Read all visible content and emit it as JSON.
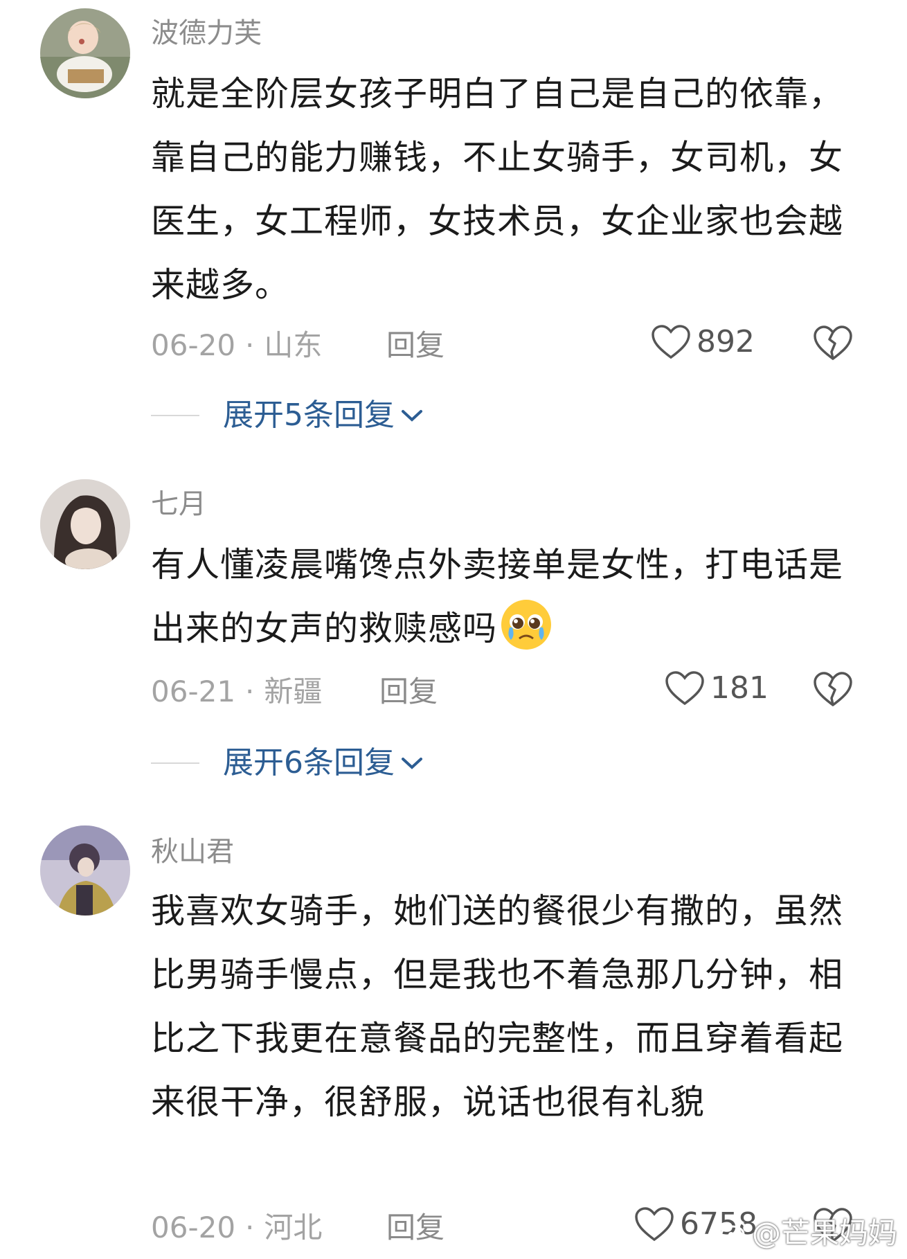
{
  "comments": [
    {
      "username": "波德力芙",
      "text": "就是全阶层女孩子明白了自己是自己的依靠，靠自己的能力赚钱，不止女骑手，女司机，女医生，女工程师，女技术员，女企业家也会越来越多。",
      "date": "06-20",
      "sep": "·",
      "location": "山东",
      "reply_label": "回复",
      "likes": "892",
      "expand_label": "展开5条回复"
    },
    {
      "username": "七月",
      "text": "有人懂凌晨嘴馋点外卖接单是女性，打电话是出来的女声的救赎感吗",
      "emoji": "pleading-crying-face",
      "date": "06-21",
      "sep": "·",
      "location": "新疆",
      "reply_label": "回复",
      "likes": "181",
      "expand_label": "展开6条回复"
    },
    {
      "username": "秋山君",
      "text": "我喜欢女骑手，她们送的餐很少有撒的，虽然比男骑手慢点，但是我也不着急那几分钟，相比之下我更在意餐品的完整性，而且穿着看起来很干净，很舒服，说话也很有礼貌",
      "date": "06-20",
      "sep": "·",
      "location": "河北",
      "reply_label": "回复",
      "likes": "6758"
    }
  ],
  "watermark": "@芒果妈妈",
  "colors": {
    "username": "#8c8c8c",
    "meta": "#a3a3a3",
    "expand": "#2c5d93",
    "body": "#1b1b1b"
  }
}
